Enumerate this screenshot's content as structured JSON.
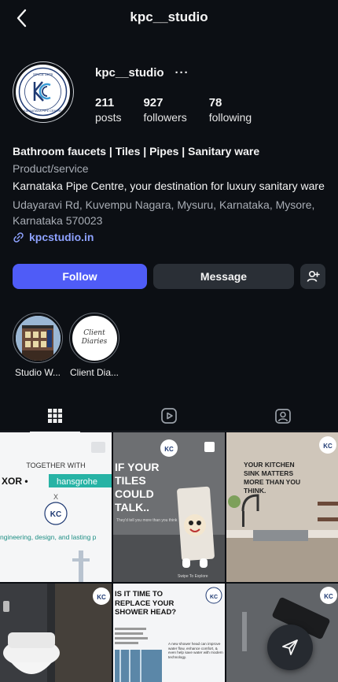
{
  "header": {
    "title": "kpc__studio"
  },
  "profile": {
    "username": "kpc__studio",
    "more": "···",
    "logo": {
      "since": "SINCE 1979",
      "name": "KARNATAKA PIPE CENTRE",
      "initials": "KPC"
    },
    "stats": [
      {
        "value": "211",
        "label": "posts"
      },
      {
        "value": "927",
        "label": "followers"
      },
      {
        "value": "78",
        "label": "following"
      }
    ]
  },
  "bio": {
    "headline": "Bathroom faucets | Tiles | Pipes | Sanitary ware",
    "category": "Product/service",
    "description": "Karnataka Pipe Centre, your destination for luxury sanitary ware",
    "address": "Udayaravi Rd, Kuvempu Nagara, Mysuru, Karnataka, Mysore, Karnataka 570023",
    "link": "kpcstudio.in"
  },
  "actions": {
    "follow": "Follow",
    "message": "Message"
  },
  "highlights": [
    {
      "label": "Studio W..."
    },
    {
      "label": "Client Dia...",
      "cover_text": "Client Diaries"
    }
  ],
  "posts": {
    "p1": {
      "line1": "TOGETHER WITH",
      "brand1": "XOR •",
      "brand2": "hansgrohe",
      "x": "X",
      "tagline": "ngineering, design, and lasting p"
    },
    "p2": {
      "headline": "IF YOUR TILES COULD TALK..",
      "sub": "They'd tell you more than you think",
      "swipe": "Swipe To Explore"
    },
    "p3": {
      "headline": "YOUR KITCHEN SINK MATTERS MORE THAN YOU THINK."
    },
    "p5": {
      "headline": "IS IT TIME TO REPLACE YOUR SHOWER HEAD?",
      "body": "A new shower head can improve water flow, enhance comfort, & even help save water with modern technology."
    }
  },
  "colors": {
    "accent": "#4f5cf7",
    "link": "#8ea2ff",
    "background": "#0c0f14"
  }
}
